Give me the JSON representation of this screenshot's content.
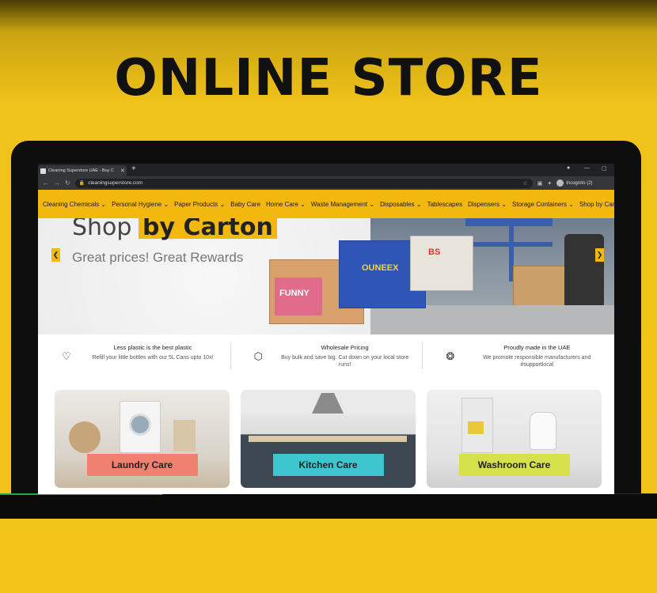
{
  "headline": "ONLINE STORE",
  "browser": {
    "tab_title": "Cleaning Superstore UAE - Buy C",
    "new_tab": "+",
    "url": "cleaningsuperstore.com",
    "profile": "Incognito (2)"
  },
  "nav": {
    "items": [
      "Cleaning Chemicals ⌄",
      "Personal Hygiene ⌄",
      "Paper Products ⌄",
      "Baby Care",
      "Home Care ⌄",
      "Waste Management ⌄",
      "Disposables ⌄",
      "Tablescapes",
      "Dispensers ⌄",
      "Storage Containers ⌄",
      "Shop by Carton"
    ]
  },
  "hero": {
    "title_a": "Shop",
    "title_b": "by Carton",
    "subtitle": "Great prices! Great Rewards",
    "box_brand_1": "FUNNY",
    "box_brand_2": "OUNEEX",
    "box_brand_3": "BS"
  },
  "features": [
    {
      "icon": "heart-icon",
      "title": "Less plastic is the best plastic",
      "desc": "Refill your little bottles with our 5L Cans upto 10x!"
    },
    {
      "icon": "box-icon",
      "title": "Wholesale Pricing",
      "desc": "Buy bulk and save big. Cut down on your local store runs!"
    },
    {
      "icon": "award-icon",
      "title": "Proudly made in the UAE",
      "desc": "We promote responsible manufacturers and #supportlocal"
    }
  ],
  "categories": [
    {
      "label": "Laundry Care",
      "color": "#f08070"
    },
    {
      "label": "Kitchen Care",
      "color": "#3ec6cf"
    },
    {
      "label": "Washroom Care",
      "color": "#d6e04a"
    }
  ],
  "colors": {
    "brand_yellow": "#f2b80d",
    "background_yellow": "#f3c51b"
  }
}
